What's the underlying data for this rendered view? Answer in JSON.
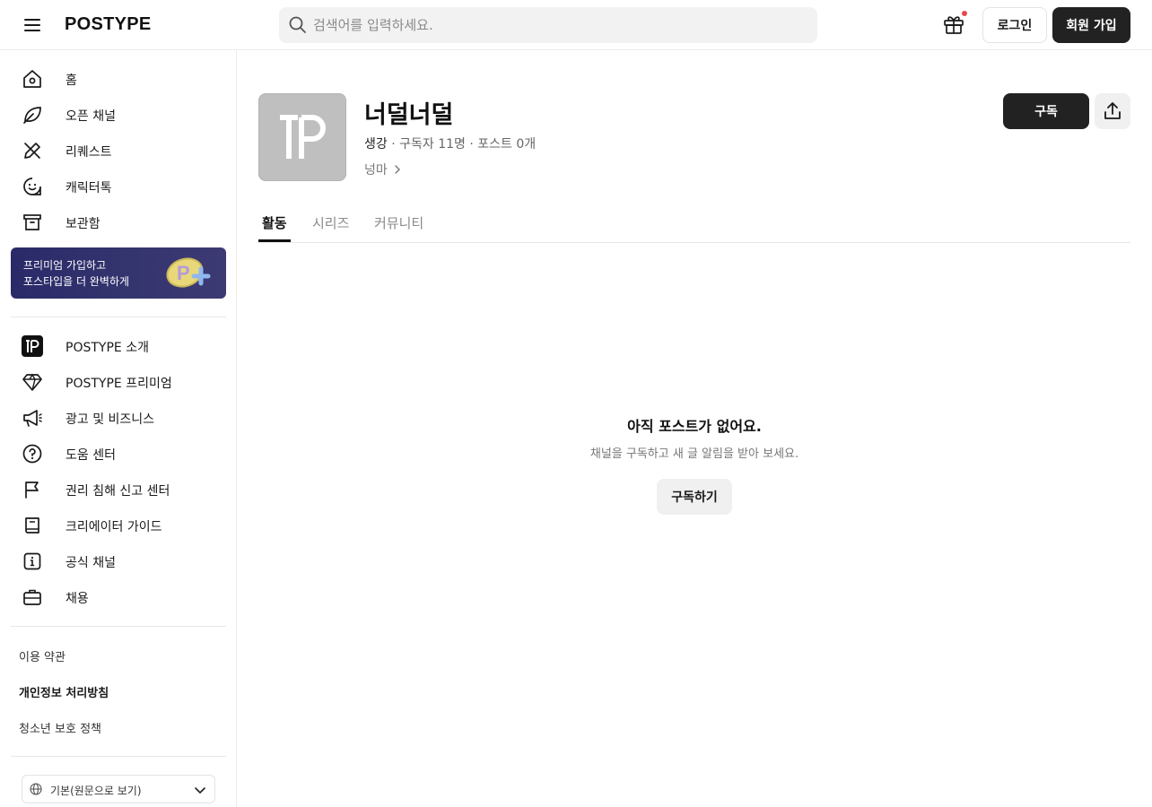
{
  "header": {
    "logo": "POSTYPE",
    "search_placeholder": "검색어를 입력하세요.",
    "login_label": "로그인",
    "signup_label": "회원 가입",
    "menu_icon": "hamburger-menu-icon",
    "gift_icon": "gift-icon",
    "notification_dot_color": "#e5484d"
  },
  "sidebar": {
    "main_nav": [
      {
        "label": "홈",
        "icon": "home-icon"
      },
      {
        "label": "오픈 채널",
        "icon": "leaf-icon"
      },
      {
        "label": "리퀘스트",
        "icon": "pencil-ruler-icon"
      },
      {
        "label": "캐릭터톡",
        "icon": "smile-chat-icon"
      },
      {
        "label": "보관함",
        "icon": "archive-box-icon"
      }
    ],
    "promo": {
      "line1": "프리미엄 가입하고",
      "line2": "포스타입을 더 완벽하게",
      "badge_icon": "premium-coin-icon"
    },
    "info_nav": [
      {
        "label": "POSTYPE 소개",
        "icon": "postype-logo-icon"
      },
      {
        "label": "POSTYPE 프리미엄",
        "icon": "diamond-icon"
      },
      {
        "label": "광고 및 비즈니스",
        "icon": "megaphone-icon"
      },
      {
        "label": "도움 센터",
        "icon": "question-circle-icon"
      },
      {
        "label": "권리 침해 신고 센터",
        "icon": "flag-icon"
      },
      {
        "label": "크리에이터 가이드",
        "icon": "book-icon"
      },
      {
        "label": "공식 채널",
        "icon": "info-square-icon"
      },
      {
        "label": "채용",
        "icon": "briefcase-icon"
      }
    ],
    "footer_links": [
      {
        "label": "이용 약관"
      },
      {
        "label": "개인정보 처리방침"
      },
      {
        "label": "청소년 보호 정책"
      }
    ],
    "language": {
      "value": "기본(원문으로 보기)",
      "icon": "globe-icon"
    }
  },
  "channel": {
    "title": "너덜너덜",
    "owner": "생강",
    "stats": " · 구독자 11명 · 포스트 0개",
    "link_label": "넝마",
    "subscribe_label": "구독",
    "share_icon": "share-upload-icon",
    "avatar_icon": "postype-logo-icon"
  },
  "tabs": [
    {
      "label": "활동",
      "active": true
    },
    {
      "label": "시리즈",
      "active": false
    },
    {
      "label": "커뮤니티",
      "active": false
    }
  ],
  "empty_state": {
    "title": "아직 포스트가 없어요.",
    "subtitle": "채널을 구독하고 새 글 알림을 받아 보세요.",
    "button_label": "구독하기"
  },
  "colors": {
    "primary_button": "#222222",
    "promo_background": "#2f2f6c",
    "avatar_background": "#bfbfbf"
  }
}
